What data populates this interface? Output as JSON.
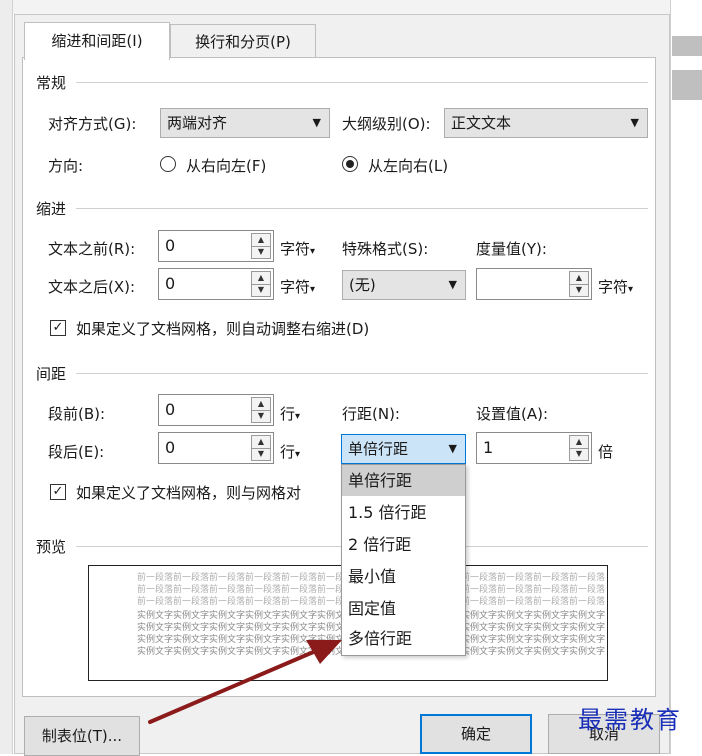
{
  "tabs": [
    {
      "label": "缩进和间距(I)",
      "active": true
    },
    {
      "label": "换行和分页(P)",
      "active": false
    }
  ],
  "general": {
    "section_label": "常规",
    "alignment_label": "对齐方式(G):",
    "alignment_value": "两端对齐",
    "outline_label": "大纲级别(O):",
    "outline_value": "正文文本",
    "direction_label": "方向:",
    "rtl_label": "从右向左(F)",
    "ltr_label": "从左向右(L)"
  },
  "indent": {
    "section_label": "缩进",
    "before_label": "文本之前(R):",
    "before_value": "0",
    "before_unit": "字符",
    "after_label": "文本之后(X):",
    "after_value": "0",
    "after_unit": "字符",
    "special_label": "特殊格式(S):",
    "special_value": "(无)",
    "measure_label": "度量值(Y):",
    "measure_value": "",
    "measure_unit": "字符",
    "auto_adjust_label": "如果定义了文档网格，则自动调整右缩进(D)"
  },
  "spacing": {
    "section_label": "间距",
    "before_label": "段前(B):",
    "before_value": "0",
    "before_unit": "行",
    "after_label": "段后(E):",
    "after_value": "0",
    "after_unit": "行",
    "line_spacing_label": "行距(N):",
    "line_spacing_value": "单倍行距",
    "setting_label": "设置值(A):",
    "setting_value": "1",
    "setting_unit": "倍",
    "grid_align_label": "如果定义了文档网格，则与网格对"
  },
  "line_spacing_options": [
    "单倍行距",
    "1.5 倍行距",
    "2 倍行距",
    "最小值",
    "固定值",
    "多倍行距"
  ],
  "preview": {
    "section_label": "预览",
    "lines": [
      "前一段落前一段落前一段落前一段落前一段落前一段落前一段落前一段落前一段落前一段落前一段落前一段落前一段落",
      "前一段落前一段落前一段落前一段落前一段落前一段落前一段落前一段落前一段落前一段落前一段落前一段落前一段落",
      "前一段落前一段落前一段落前一段落前一段落前一段落前一段落前一段落前一段落前一段落前一段落前一段落前一段落",
      "实例文字实例文字实例文字实例文字实例文字实例文字实例文字实例文字实例文字实例文字实例文字实例文字实例文字",
      "实例文字实例文字实例文字实例文字实例文字实例文字实例文字实例文字实例文字实例文字实例文字实例文字实例文字",
      "实例文字实例文字实例文字实例文字实例文字实例文字实例文字实例文字实例文字实例文字实例文字实例文字实例文字",
      "实例文字实例文字实例文字实例文字实例文字实例文字实例文字实例文字实例文字实例文字实例文字实例文字实例文字"
    ]
  },
  "buttons": {
    "tabs_label": "制表位(T)...",
    "ok_label": "确定",
    "cancel_label": "取消"
  },
  "watermark": "最需教育",
  "colors": {
    "accent": "#0078d7",
    "arrow": "#8b1a1a",
    "watermark": "#1a2fb8"
  }
}
